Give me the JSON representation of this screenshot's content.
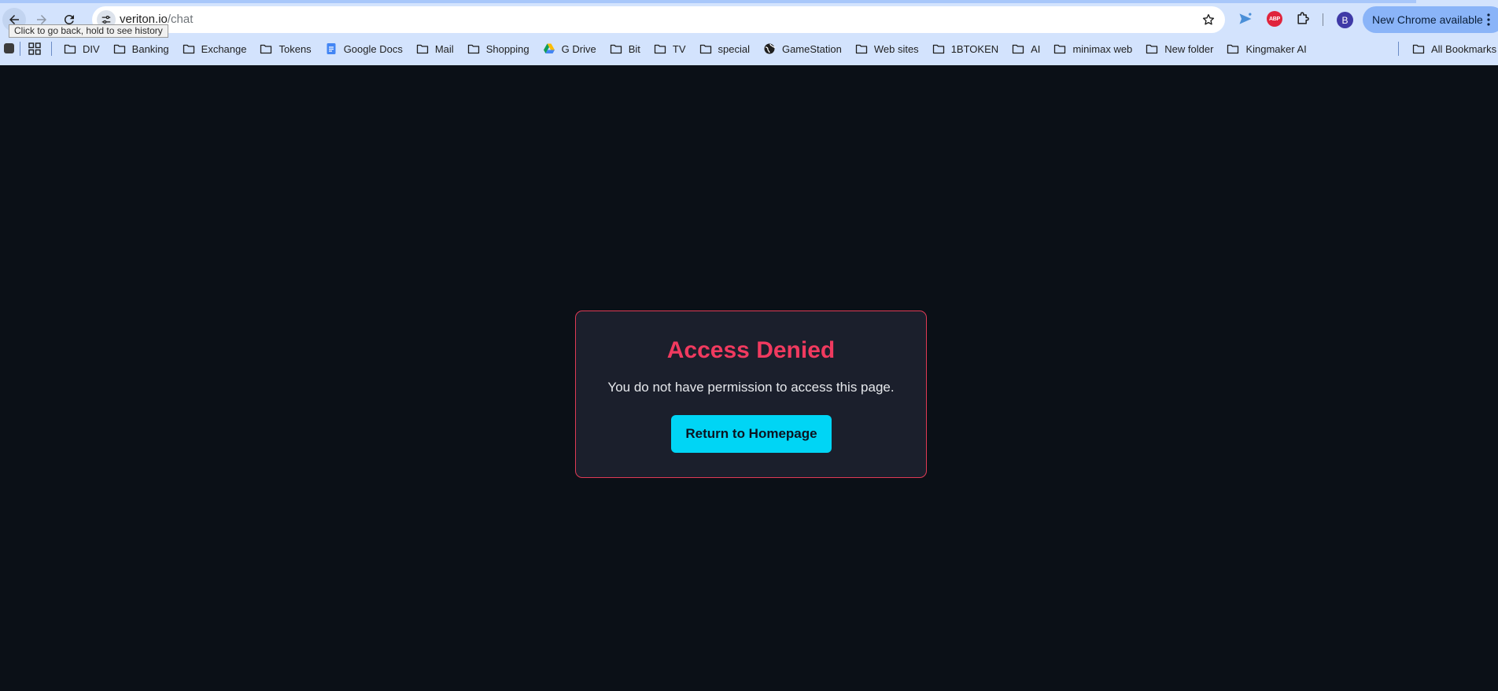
{
  "browser": {
    "tooltip": "Click to go back, hold to see history",
    "url_host": "veriton.io",
    "url_path": "/chat",
    "avatar_initial": "B",
    "update_label": "New Chrome available",
    "abp_label": "ABP",
    "icons": {
      "back": "arrow-left-icon",
      "forward": "arrow-right-icon",
      "reload": "reload-icon",
      "site_info": "tune-icon",
      "bookmark": "star-icon",
      "extension_send": "send-icon",
      "extension_abp": "adblock-icon",
      "extensions": "puzzle-icon",
      "menu": "more-vert-icon"
    }
  },
  "bookmarks": {
    "items": [
      {
        "label": "DIV",
        "icon": "folder-icon"
      },
      {
        "label": "Banking",
        "icon": "folder-icon"
      },
      {
        "label": "Exchange",
        "icon": "folder-icon"
      },
      {
        "label": "Tokens",
        "icon": "folder-icon"
      },
      {
        "label": "Google Docs",
        "icon": "google-docs-icon"
      },
      {
        "label": "Mail",
        "icon": "folder-icon"
      },
      {
        "label": "Shopping",
        "icon": "folder-icon"
      },
      {
        "label": "G Drive",
        "icon": "google-drive-icon"
      },
      {
        "label": "Bit",
        "icon": "folder-icon"
      },
      {
        "label": "TV",
        "icon": "folder-icon"
      },
      {
        "label": "special",
        "icon": "folder-icon"
      },
      {
        "label": "GameStation",
        "icon": "globe-icon"
      },
      {
        "label": "Web sites",
        "icon": "folder-icon"
      },
      {
        "label": "1BTOKEN",
        "icon": "folder-icon"
      },
      {
        "label": "AI",
        "icon": "folder-icon"
      },
      {
        "label": "minimax web",
        "icon": "folder-icon"
      },
      {
        "label": "New folder",
        "icon": "folder-icon"
      },
      {
        "label": "Kingmaker AI",
        "icon": "folder-icon"
      }
    ],
    "all_bookmarks": "All Bookmarks"
  },
  "page": {
    "title": "Access Denied",
    "message": "You do not have permission to access this page.",
    "button_label": "Return to Homepage"
  },
  "colors": {
    "page_background": "#0b1017",
    "card_background": "#1b1f2c",
    "card_border": "#e03a55",
    "title": "#f03a5f",
    "button": "#00d5f5"
  }
}
